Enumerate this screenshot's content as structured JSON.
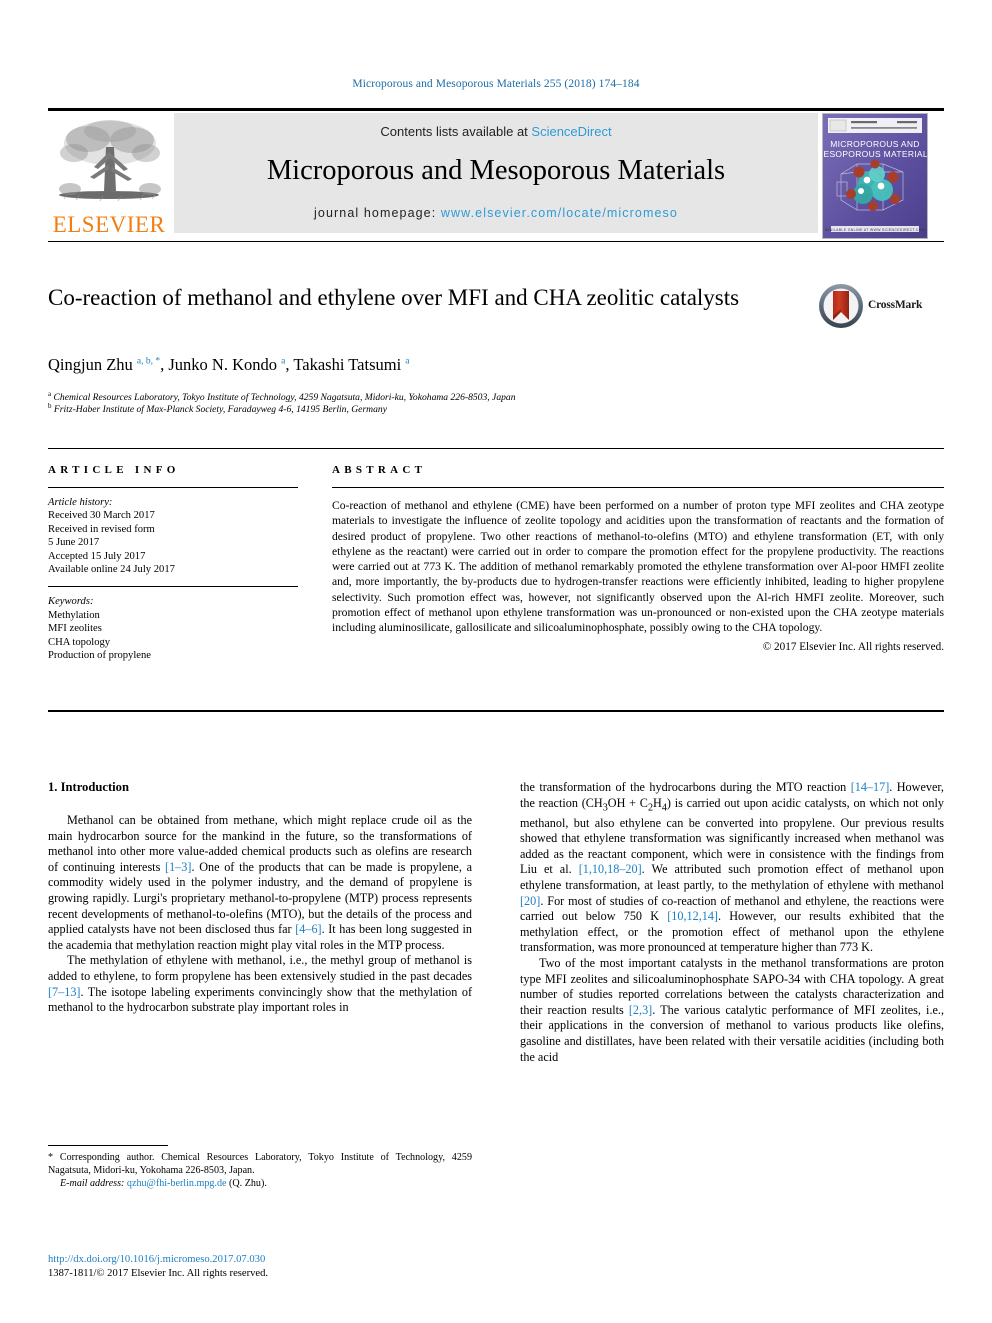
{
  "running_head": "Microporous and Mesoporous Materials 255 (2018) 174–184",
  "masthead": {
    "contents_prefix": "Contents lists available at ",
    "sciencedirect": "ScienceDirect",
    "journal_title": "Microporous and Mesoporous Materials",
    "homepage_prefix": "journal homepage: ",
    "homepage_url": "www.elsevier.com/locate/micromeso",
    "publisher_wordmark": "ELSEVIER",
    "cover_title_line1": "MICROPOROUS AND",
    "cover_title_line2": "MESOPOROUS MATERIALS",
    "cover_publisher": "ELSEVIER"
  },
  "article": {
    "title": "Co-reaction of methanol and ethylene over MFI and CHA zeolitic catalysts",
    "crossmark_label": "CrossMark",
    "authors_html": "Qingjun Zhu <sup>a, b, *</sup>, Junko N. Kondo <sup>a</sup>, Takashi Tatsumi <sup>a</sup>",
    "affiliation_a": "Chemical Resources Laboratory, Tokyo Institute of Technology, 4259 Nagatsuta, Midori-ku, Yokohama 226-8503, Japan",
    "affiliation_b": "Fritz-Haber Institute of Max-Planck Society, Faradayweg 4-6, 14195 Berlin, Germany",
    "affiliation_a_mark": "a",
    "affiliation_b_mark": "b"
  },
  "article_info": {
    "heading": "ARTICLE INFO",
    "history_label": "Article history:",
    "history": [
      "Received 30 March 2017",
      "Received in revised form",
      "5 June 2017",
      "Accepted 15 July 2017",
      "Available online 24 July 2017"
    ],
    "keywords_label": "Keywords:",
    "keywords": [
      "Methylation",
      "MFI zeolites",
      "CHA topology",
      "Production of propylene"
    ]
  },
  "abstract": {
    "heading": "ABSTRACT",
    "text": "Co-reaction of methanol and ethylene (CME) have been performed on a number of proton type MFI zeolites and CHA zeotype materials to investigate the influence of zeolite topology and acidities upon the transformation of reactants and the formation of desired product of propylene. Two other reactions of methanol-to-olefins (MTO) and ethylene transformation (ET, with only ethylene as the reactant) were carried out in order to compare the promotion effect for the propylene productivity. The reactions were carried out at 773 K. The addition of methanol remarkably promoted the ethylene transformation over Al-poor HMFI zeolite and, more importantly, the by-products due to hydrogen-transfer reactions were efficiently inhibited, leading to higher propylene selectivity. Such promotion effect was, however, not significantly observed upon the Al-rich HMFI zeolite. Moreover, such promotion effect of methanol upon ethylene transformation was un-pronounced or non-existed upon the CHA zeotype materials including aluminosilicate, gallosilicate and silicoaluminophosphate, possibly owing to the CHA topology.",
    "copyright": "© 2017 Elsevier Inc. All rights reserved."
  },
  "body": {
    "section_heading": "1. Introduction",
    "left_paragraphs": [
      "Methanol can be obtained from methane, which might replace crude oil as the main hydrocarbon source for the mankind in the future, so the transformations of methanol into other more value-added chemical products such as olefins are research of continuing interests [1–3]. One of the products that can be made is propylene, a commodity widely used in the polymer industry, and the demand of propylene is growing rapidly. Lurgi's proprietary methanol-to-propylene (MTP) process represents recent developments of methanol-to-olefins (MTO), but the details of the process and applied catalysts have not been disclosed thus far [4–6]. It has been long suggested in the academia that methylation reaction might play vital roles in the MTP process.",
      "The methylation of ethylene with methanol, i.e., the methyl group of methanol is added to ethylene, to form propylene has been extensively studied in the past decades [7–13]. The isotope labeling experiments convincingly show that the methylation of methanol to the hydrocarbon substrate play important roles in"
    ],
    "right_paragraphs": [
      "the transformation of the hydrocarbons during the MTO reaction [14–17]. However, the reaction (CH3OH + C2H4) is carried out upon acidic catalysts, on which not only methanol, but also ethylene can be converted into propylene. Our previous results showed that ethylene transformation was significantly increased when methanol was added as the reactant component, which were in consistence with the findings from Liu et al. [1,10,18–20]. We attributed such promotion effect of methanol upon ethylene transformation, at least partly, to the methylation of ethylene with methanol [20]. For most of studies of co-reaction of methanol and ethylene, the reactions were carried out below 750 K [10,12,14]. However, our results exhibited that the methylation effect, or the promotion effect of methanol upon the ethylene transformation, was more pronounced at temperature higher than 773 K.",
      "Two of the most important catalysts in the methanol transformations are proton type MFI zeolites and silicoaluminophosphate SAPO-34 with CHA topology. A great number of studies reported correlations between the catalysts characterization and their reaction results [2,3]. The various catalytic performance of MFI zeolites, i.e., their applications in the conversion of methanol to various products like olefins, gasoline and distillates, have been related with their versatile acidities (including both the acid"
    ]
  },
  "footnote": {
    "corresponding": "* Corresponding author. Chemical Resources Laboratory, Tokyo Institute of Technology, 4259 Nagatsuta, Midori-ku, Yokohama 226-8503, Japan.",
    "email_label": "E-mail address:",
    "email": "qzhu@fhi-berlin.mpg.de",
    "email_suffix": "(Q. Zhu)."
  },
  "doi_block": {
    "doi_url": "http://dx.doi.org/10.1016/j.micromeso.2017.07.030",
    "issn_line": "1387-1811/© 2017 Elsevier Inc. All rights reserved."
  },
  "colors": {
    "link": "#1b7fc4",
    "sciencedirect": "#2e9bd6",
    "elsevier_orange": "#f07f13",
    "band_gray": "#e6e6e6"
  }
}
